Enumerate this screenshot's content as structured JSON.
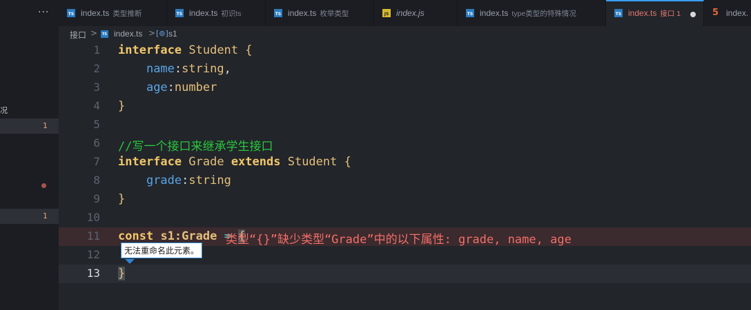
{
  "sidebar": {
    "more": "···",
    "fragment": "况",
    "badge1": "1",
    "badge2": "1"
  },
  "tabs": [
    {
      "kind": "ts",
      "name": "index.ts",
      "desc": "类型推断"
    },
    {
      "kind": "ts",
      "name": "index.ts",
      "desc": "初识ts"
    },
    {
      "kind": "ts",
      "name": "index.ts",
      "desc": "枚举类型"
    },
    {
      "kind": "js",
      "name": "index.js",
      "desc": ""
    },
    {
      "kind": "ts",
      "name": "index.ts",
      "desc": "type类型的特殊情况"
    },
    {
      "kind": "ts",
      "name": "index.ts",
      "desc": "接口 1",
      "active": true
    },
    {
      "kind": "html",
      "name": "index.",
      "desc": ""
    }
  ],
  "icons": {
    "ts": "TS",
    "js": "JS",
    "html": "5",
    "var": "[⊚]"
  },
  "breadcrumb": {
    "folder": "接口",
    "file": "index.ts",
    "symbol": "s1",
    "sep": ">"
  },
  "lines": [
    "1",
    "2",
    "3",
    "4",
    "5",
    "6",
    "7",
    "8",
    "9",
    "10",
    "11",
    "12",
    "13"
  ],
  "code": {
    "l1": {
      "kw": "interface",
      "name": "Student",
      "brace": "{"
    },
    "l2": {
      "prop": "name",
      "type": "string",
      "end": ","
    },
    "l3": {
      "prop": "age",
      "type": "number"
    },
    "l4": {
      "brace": "}"
    },
    "l6": {
      "comment": "//写一个接口来继承学生接口"
    },
    "l7": {
      "kw": "interface",
      "name": "Grade",
      "ext": "extends",
      "base": "Student",
      "brace": "{"
    },
    "l8": {
      "prop": "grade",
      "type": "string"
    },
    "l9": {
      "brace": "}"
    },
    "l11": {
      "kw": "const",
      "name": "s1:Grade",
      "op": "=",
      "brace": "{",
      "diagnostic": "类型“{}”缺少类型“Grade”中的以下属性: grade, name, age"
    },
    "l13": {
      "brace": "}"
    }
  },
  "tooltip": "无法重命名此元素。",
  "colors": {
    "accent": "#3aa0ff",
    "error": "#f16f68",
    "keyword": "#f2c76a",
    "comment": "#29c73c"
  }
}
